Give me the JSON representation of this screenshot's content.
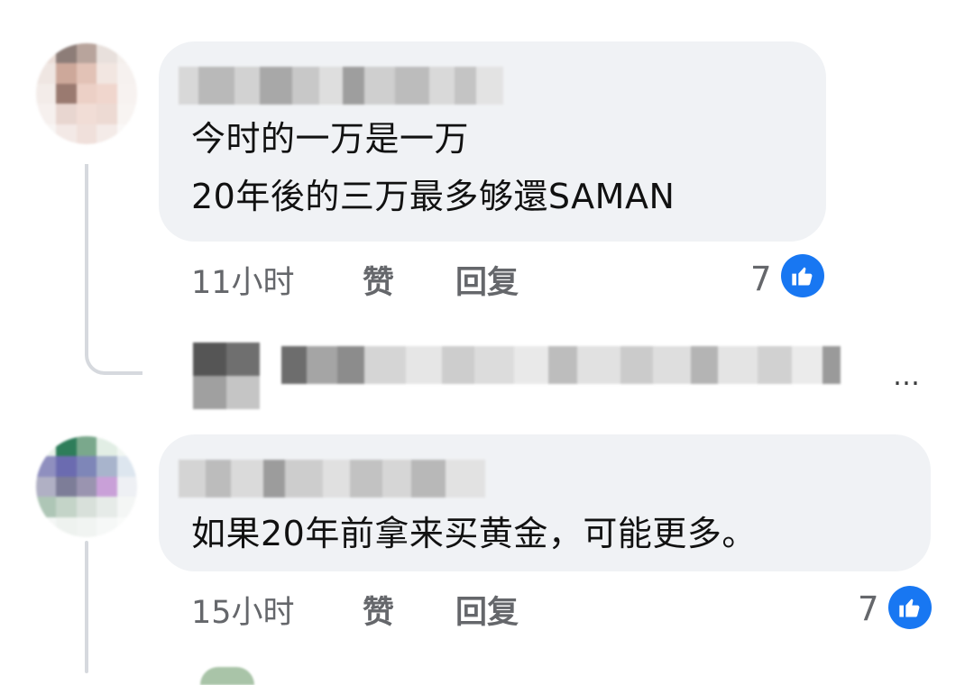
{
  "comments": [
    {
      "author": "",
      "lines": [
        "今时的一万是一万",
        "20年後的三万最多够還SAMAN"
      ],
      "time": "11小时",
      "like_action": "赞",
      "reply_action": "回复",
      "like_count": "7",
      "reaction_icon": "thumbs-up-icon",
      "reaction_color": "#1877f2"
    },
    {
      "author": "",
      "lines": [
        "如果20年前拿来买黄金，可能更多。"
      ],
      "time": "15小时",
      "like_action": "赞",
      "reply_action": "回复",
      "like_count": "7",
      "reaction_icon": "thumbs-up-icon",
      "reaction_color": "#1877f2"
    }
  ],
  "collapsed_reply": {
    "more_indicator": "…"
  },
  "colors": {
    "bubble": "#f0f2f5",
    "meta_text": "#65676b",
    "thread_line": "#d6d9de",
    "like_blue": "#1877f2"
  }
}
